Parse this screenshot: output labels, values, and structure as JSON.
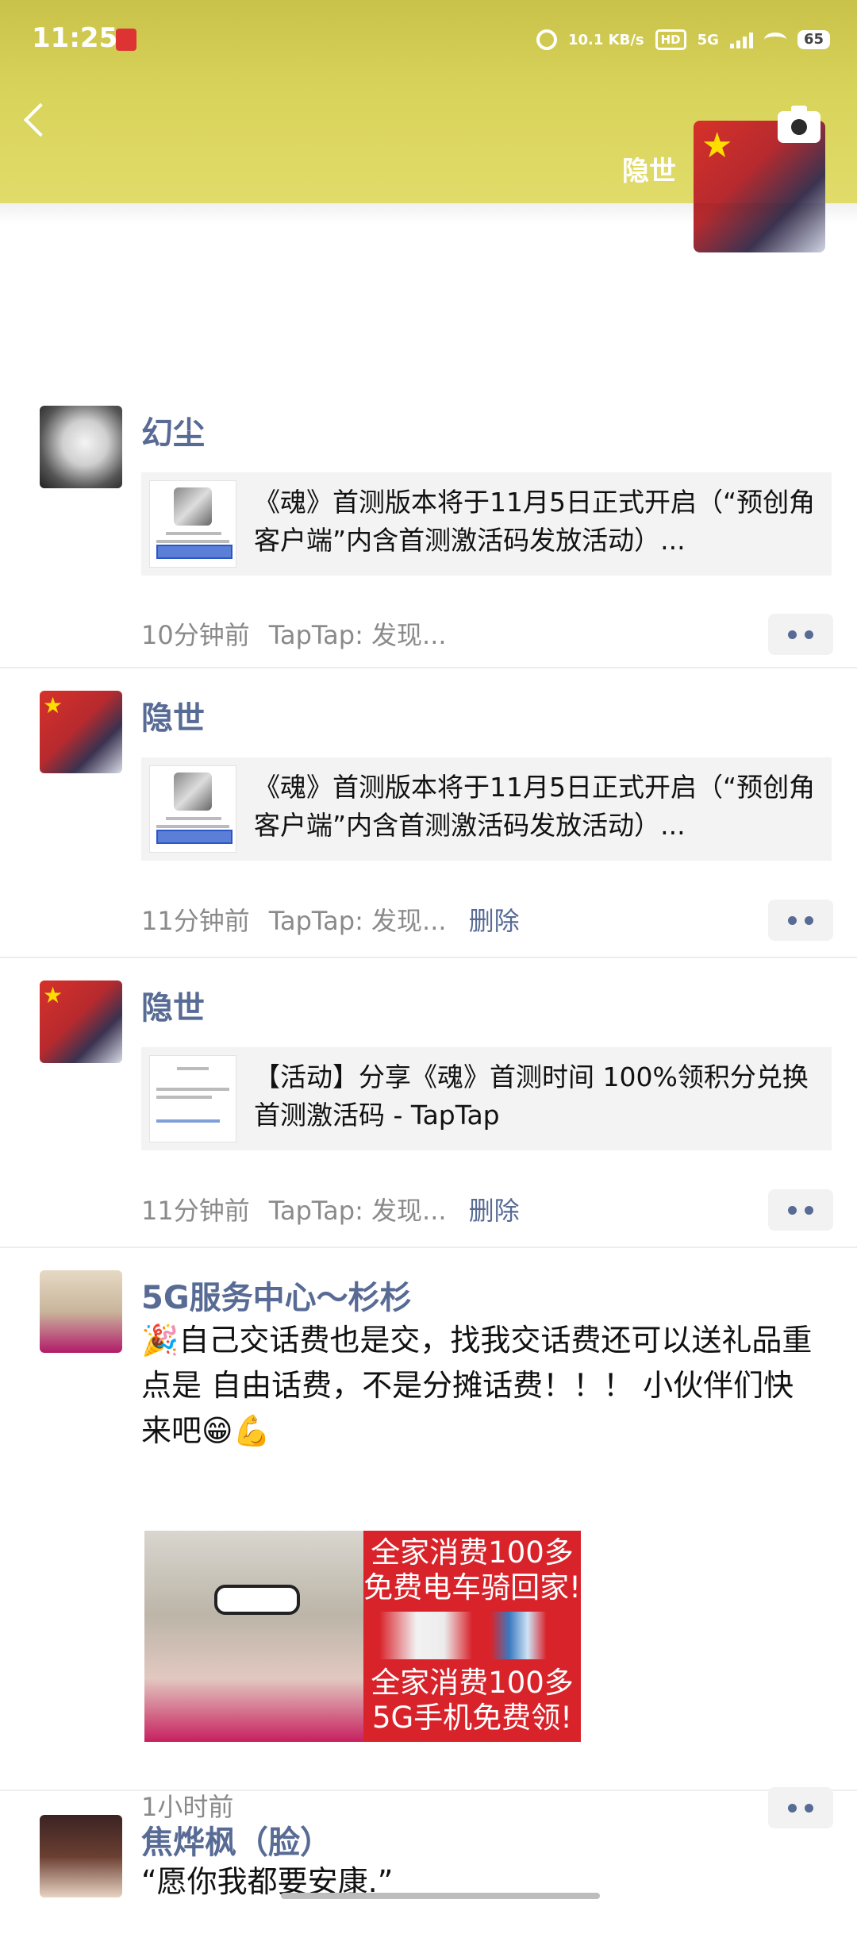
{
  "status_bar": {
    "time": "11:25",
    "net_speed": "10.1 KB/s",
    "hd": "HD",
    "network": "5G",
    "battery": "65"
  },
  "header": {
    "name": "隐世",
    "back_icon": "chevron-left-icon",
    "camera_icon": "camera-icon"
  },
  "posts": [
    {
      "name": "幻尘",
      "share_text": "《魂》首测版本将于11月5日正式开启（“预创角客户端”内含首测激活码发放活动）...",
      "time": "10分钟前",
      "source": "TapTap: 发现...",
      "delete": ""
    },
    {
      "name": "隐世",
      "share_text": "《魂》首测版本将于11月5日正式开启（“预创角客户端”内含首测激活码发放活动）...",
      "time": "11分钟前",
      "source": "TapTap: 发现...",
      "delete": "删除"
    },
    {
      "name": "隐世",
      "share_text": "【活动】分享《魂》首测时间 100%领积分兑换首测激活码 - TapTap",
      "time": "11分钟前",
      "source": "TapTap: 发现...",
      "delete": "删除"
    },
    {
      "name": "5G服务中心～杉杉",
      "text": "🎉自己交话费也是交，找我交话费还可以送礼品重点是   自由话费，不是分摊话费！！！ 小伙伴们快来吧😁💪",
      "image_text_top": "全家消费100多免费电车骑回家!",
      "image_text_bottom": "全家消费100多5G手机免费领!",
      "time": "1小时前"
    },
    {
      "name": "焦烨枫（脸）",
      "text": "“愿你我都要安康.”"
    }
  ]
}
